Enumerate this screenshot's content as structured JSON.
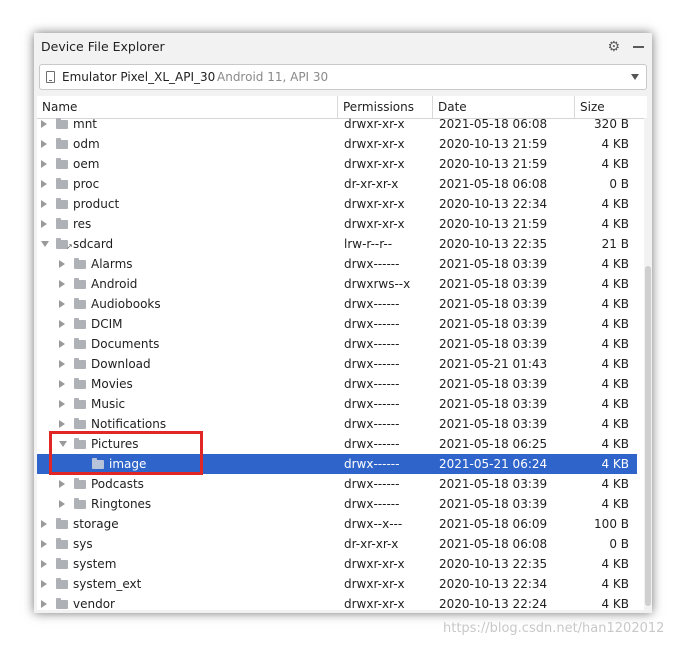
{
  "window": {
    "title": "Device File Explorer",
    "icons": [
      "gear-icon",
      "minimize-icon"
    ]
  },
  "device_selector": {
    "name": "Emulator Pixel_XL_API_30",
    "detail": "Android 11, API 30"
  },
  "columns": {
    "name": "Name",
    "permissions": "Permissions",
    "date": "Date",
    "size": "Size"
  },
  "rows": [
    {
      "name": "mnt",
      "permissions": "drwxr-xr-x",
      "date": "2021-05-18 06:08",
      "size": "320 B",
      "level": 0,
      "expanded": false,
      "selected": false
    },
    {
      "name": "odm",
      "permissions": "drwxr-xr-x",
      "date": "2020-10-13 21:59",
      "size": "4 KB",
      "level": 0,
      "expanded": false,
      "selected": false
    },
    {
      "name": "oem",
      "permissions": "drwxr-xr-x",
      "date": "2020-10-13 21:59",
      "size": "4 KB",
      "level": 0,
      "expanded": false,
      "selected": false
    },
    {
      "name": "proc",
      "permissions": "dr-xr-xr-x",
      "date": "2021-05-18 06:08",
      "size": "0 B",
      "level": 0,
      "expanded": false,
      "selected": false
    },
    {
      "name": "product",
      "permissions": "drwxr-xr-x",
      "date": "2020-10-13 22:34",
      "size": "4 KB",
      "level": 0,
      "expanded": false,
      "selected": false
    },
    {
      "name": "res",
      "permissions": "drwxr-xr-x",
      "date": "2020-10-13 21:59",
      "size": "4 KB",
      "level": 0,
      "expanded": false,
      "selected": false
    },
    {
      "name": "sdcard",
      "permissions": "lrw-r--r--",
      "date": "2020-10-13 22:35",
      "size": "21 B",
      "level": 0,
      "expanded": true,
      "selected": false,
      "link": true
    },
    {
      "name": "Alarms",
      "permissions": "drwx------",
      "date": "2021-05-18 03:39",
      "size": "4 KB",
      "level": 1,
      "expanded": false,
      "selected": false
    },
    {
      "name": "Android",
      "permissions": "drwxrws--x",
      "date": "2021-05-18 03:39",
      "size": "4 KB",
      "level": 1,
      "expanded": false,
      "selected": false
    },
    {
      "name": "Audiobooks",
      "permissions": "drwx------",
      "date": "2021-05-18 03:39",
      "size": "4 KB",
      "level": 1,
      "expanded": false,
      "selected": false
    },
    {
      "name": "DCIM",
      "permissions": "drwx------",
      "date": "2021-05-18 03:39",
      "size": "4 KB",
      "level": 1,
      "expanded": false,
      "selected": false
    },
    {
      "name": "Documents",
      "permissions": "drwx------",
      "date": "2021-05-18 03:39",
      "size": "4 KB",
      "level": 1,
      "expanded": false,
      "selected": false
    },
    {
      "name": "Download",
      "permissions": "drwx------",
      "date": "2021-05-21 01:43",
      "size": "4 KB",
      "level": 1,
      "expanded": false,
      "selected": false
    },
    {
      "name": "Movies",
      "permissions": "drwx------",
      "date": "2021-05-18 03:39",
      "size": "4 KB",
      "level": 1,
      "expanded": false,
      "selected": false
    },
    {
      "name": "Music",
      "permissions": "drwx------",
      "date": "2021-05-18 03:39",
      "size": "4 KB",
      "level": 1,
      "expanded": false,
      "selected": false
    },
    {
      "name": "Notifications",
      "permissions": "drwx------",
      "date": "2021-05-18 03:39",
      "size": "4 KB",
      "level": 1,
      "expanded": false,
      "selected": false
    },
    {
      "name": "Pictures",
      "permissions": "drwx------",
      "date": "2021-05-18 06:25",
      "size": "4 KB",
      "level": 1,
      "expanded": true,
      "selected": false
    },
    {
      "name": "image",
      "permissions": "drwx------",
      "date": "2021-05-21 06:24",
      "size": "4 KB",
      "level": 2,
      "expanded": null,
      "selected": true
    },
    {
      "name": "Podcasts",
      "permissions": "drwx------",
      "date": "2021-05-18 03:39",
      "size": "4 KB",
      "level": 1,
      "expanded": false,
      "selected": false
    },
    {
      "name": "Ringtones",
      "permissions": "drwx------",
      "date": "2021-05-18 03:39",
      "size": "4 KB",
      "level": 1,
      "expanded": false,
      "selected": false
    },
    {
      "name": "storage",
      "permissions": "drwx--x---",
      "date": "2021-05-18 06:09",
      "size": "100 B",
      "level": 0,
      "expanded": false,
      "selected": false
    },
    {
      "name": "sys",
      "permissions": "dr-xr-xr-x",
      "date": "2021-05-18 06:08",
      "size": "0 B",
      "level": 0,
      "expanded": false,
      "selected": false
    },
    {
      "name": "system",
      "permissions": "drwxr-xr-x",
      "date": "2020-10-13 22:35",
      "size": "4 KB",
      "level": 0,
      "expanded": false,
      "selected": false
    },
    {
      "name": "system_ext",
      "permissions": "drwxr-xr-x",
      "date": "2020-10-13 22:34",
      "size": "4 KB",
      "level": 0,
      "expanded": false,
      "selected": false
    },
    {
      "name": "vendor",
      "permissions": "drwxr-xr-x",
      "date": "2020-10-13 22:24",
      "size": "4 KB",
      "level": 0,
      "expanded": false,
      "selected": false
    }
  ],
  "colors": {
    "selection": "#2f65ca",
    "highlight_box": "#e12626"
  },
  "watermark": "https://blog.csdn.net/han1202012"
}
